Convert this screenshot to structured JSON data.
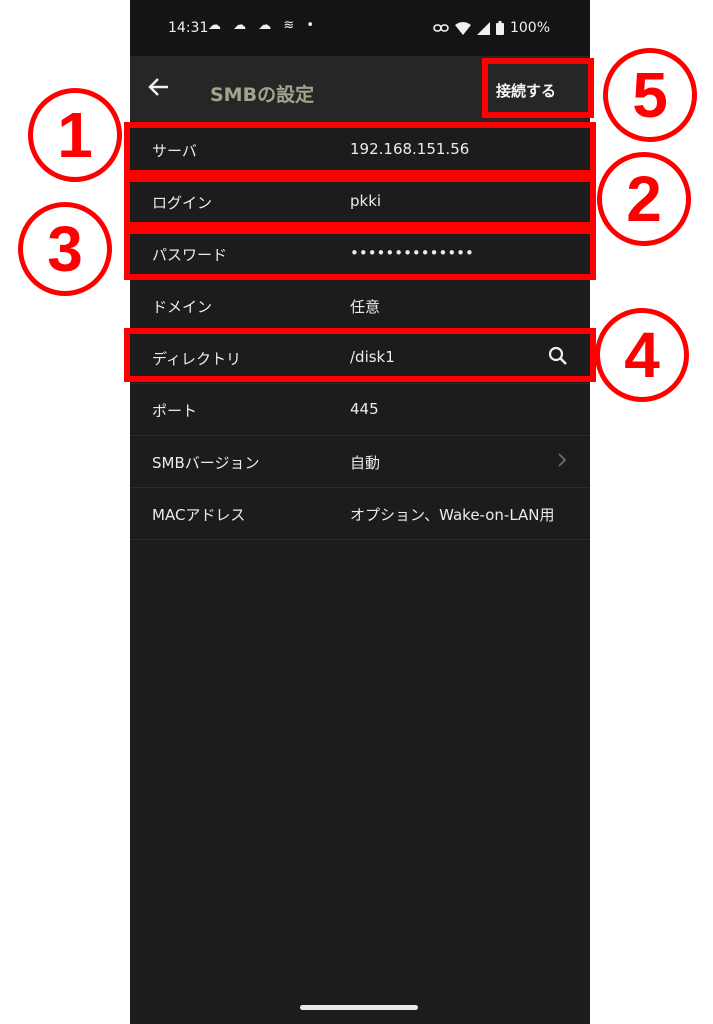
{
  "status_bar": {
    "time": "14:31",
    "notif_icons": "☁ ☁ ☁ ≋ •",
    "battery": "100%"
  },
  "app_bar": {
    "title": "SMBの設定",
    "connect_label": "接続する"
  },
  "fields": [
    {
      "label": "サーバ",
      "value": "192.168.151.56"
    },
    {
      "label": "ログイン",
      "value": "pkki"
    },
    {
      "label": "パスワード",
      "value": "••••••••••••••"
    },
    {
      "label": "ドメイン",
      "value": "任意"
    },
    {
      "label": "ディレクトリ",
      "value": "/disk1"
    },
    {
      "label": "ポート",
      "value": "445"
    },
    {
      "label": "SMBバージョン",
      "value": "自動"
    },
    {
      "label": "MACアドレス",
      "value": "オプション、Wake-on-LAN用"
    }
  ],
  "annotations": [
    "1",
    "2",
    "3",
    "4",
    "5"
  ],
  "colors": {
    "highlight": "#ff0000",
    "background": "#1c1c1c",
    "app_bar": "#262626",
    "title": "#a3a38e"
  }
}
